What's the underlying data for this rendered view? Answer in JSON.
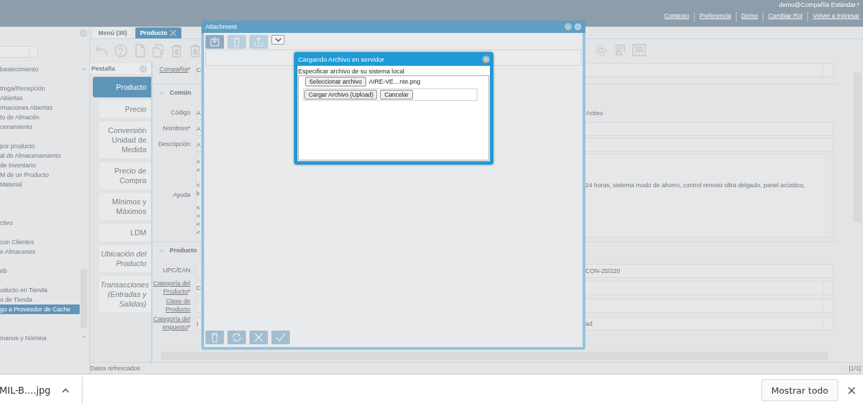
{
  "header": {
    "user": "demo@Compañía Estándar.*",
    "links": [
      "Contexto",
      "Preferencia",
      "Demo",
      "Cambiar Rol",
      "Volver a Ingresar"
    ]
  },
  "menu": {
    "groups": [
      [
        {
          "label": "bastecimiento",
          "selected": false
        }
      ],
      [
        {
          "label": "trega/Recepción",
          "selected": false
        },
        {
          "label": "Abiertas",
          "selected": false
        },
        {
          "label": "rmaciones Abiertas",
          "selected": false
        },
        {
          "label": "to de Almacén",
          "selected": false
        },
        {
          "label": "cenamiento",
          "selected": false
        }
      ],
      [
        {
          "label": "por producto",
          "selected": false
        },
        {
          "label": "al de Almacenamiento",
          "selected": false
        },
        {
          "label": "de Inventario",
          "selected": false
        },
        {
          "label": "M de un Producto",
          "selected": false
        },
        {
          "label": "Material",
          "selected": false
        }
      ],
      [
        {
          "label": "ctivo",
          "selected": false
        }
      ],
      [
        {
          "label": "con Clientes",
          "selected": false
        },
        {
          "label": "e Almacenes",
          "selected": false
        }
      ],
      [
        {
          "label": "eb",
          "selected": false
        }
      ],
      [
        {
          "label": "oducto en Tienda",
          "selected": false
        },
        {
          "label": "o de Tienda",
          "selected": false
        },
        {
          "label": "go a Proveedor de Cache",
          "selected": true
        }
      ],
      [
        {
          "label": "manos y Nómina",
          "selected": false
        }
      ]
    ]
  },
  "window_tabs": [
    {
      "label": "Menú (35)",
      "selected": false,
      "closable": false
    },
    {
      "label": "Producto",
      "selected": true,
      "closable": true
    }
  ],
  "pestana": {
    "title": "Pestaña",
    "tabs": [
      {
        "label": "Producto",
        "selected": true,
        "italic": false
      },
      {
        "label": "Precio",
        "selected": false,
        "italic": false
      },
      {
        "label": "Conversión Unidad de Medida",
        "selected": false,
        "italic": false
      },
      {
        "label": "Precio de Compra",
        "selected": false,
        "italic": false
      },
      {
        "label": "Mínimos y Máximos",
        "selected": false,
        "italic": false
      },
      {
        "label": "LDM",
        "selected": false,
        "italic": false
      },
      {
        "label": "Ubicación del Producto",
        "selected": false,
        "italic": true
      },
      {
        "label": "Transacciones (Entradas y Salidas)",
        "selected": false,
        "italic": true
      }
    ]
  },
  "form": {
    "rows": [
      {
        "kind": "select",
        "label": "Compañía",
        "link": true,
        "required_mark": "*",
        "value": "C"
      },
      {
        "kind": "section",
        "title": "Común",
        "expanded": true
      },
      {
        "kind": "text",
        "label": "Código",
        "link": false,
        "value": "A",
        "side_label": "Activo"
      },
      {
        "kind": "text",
        "label": "Nombres",
        "link": false,
        "required_mark": "*",
        "value": "A"
      },
      {
        "kind": "text",
        "label": "Descripción",
        "link": false,
        "value": "A"
      },
      {
        "kind": "textarea",
        "label": "Ayuda",
        "link": false,
        "lines": [
          {
            "kind": "text",
            "left": "<"
          },
          {
            "kind": "text",
            "left": "<"
          },
          {
            "kind": "blank"
          },
          {
            "kind": "text",
            "left": "<",
            "right": "24 horas, sistema modo de ahorro, control remoto ultra delgado, panel acústico,"
          },
          {
            "kind": "text",
            "left": "k"
          },
          {
            "kind": "blank"
          },
          {
            "kind": "text",
            "left": "<"
          },
          {
            "kind": "text",
            "left": "<"
          },
          {
            "kind": "text",
            "left": "<"
          },
          {
            "kind": "text",
            "left": "<"
          }
        ]
      },
      {
        "kind": "section",
        "title": "Producto",
        "expanded": true
      },
      {
        "kind": "text",
        "label": "UPC/EAN",
        "link": false,
        "value_right": "CON-25/220"
      },
      {
        "kind": "select",
        "label": "Categoría del Producto",
        "link": true,
        "required_mark": "*",
        "value": "C"
      },
      {
        "kind": "select",
        "label": "Clase de Producto",
        "link": true
      },
      {
        "kind": "select",
        "label": "Categoría del Impuesto",
        "link": true,
        "required_mark": "*",
        "value": "I",
        "value_right": "ad"
      }
    ]
  },
  "status": {
    "message": "Datos refrescados",
    "record": "[1/1]"
  },
  "download_bar": {
    "file": "MIL-B....jpg",
    "show_all": "Mostrar todo"
  },
  "attachment": {
    "title": "Attachment"
  },
  "upload": {
    "title": "Cargando Archivo en servidor",
    "prompt": "Especificar archivo de su sistema local",
    "choose": "Seleccionar archivo",
    "file_name": "AIRE-VE…nte.png",
    "upload": "Cargar Archivo (Upload)",
    "cancel": "Cancelar"
  }
}
